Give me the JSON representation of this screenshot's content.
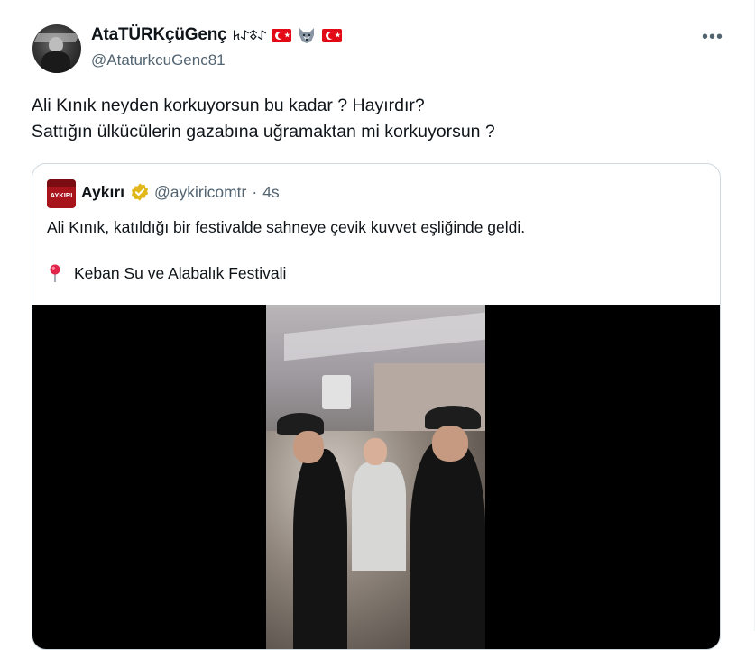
{
  "author": {
    "display_name": "AtaTÜRKçüGenç",
    "rune_text": "𐰀𐱃𐰀𐱅",
    "handle": "@AtaturkcuGenc81",
    "emojis": [
      "turkey-flag-icon",
      "wolf-icon",
      "turkey-flag-icon"
    ]
  },
  "tweet": {
    "lines": [
      "Ali Kınık neyden korkuyorsun bu kadar ? Hayırdır?",
      "Sattığın ülkücülerin gazabına uğramaktan mi korkuyorsun ?"
    ]
  },
  "quote": {
    "logo_text": "AYKIRI",
    "name": "Aykırı",
    "handle": "@aykiricomtr",
    "separator": "·",
    "time": "4s",
    "text": "Ali Kınık, katıldığı bir festivalde sahneye çevik kuvvet eşliğinde geldi.",
    "location": "Keban Su ve Alabalık Festivali"
  },
  "colors": {
    "text_primary": "#0f1419",
    "text_secondary": "#536471",
    "border": "#cfd9de",
    "verified_gold": "#e2b719",
    "logo_red": "#a8141c"
  },
  "more_button": "•••"
}
